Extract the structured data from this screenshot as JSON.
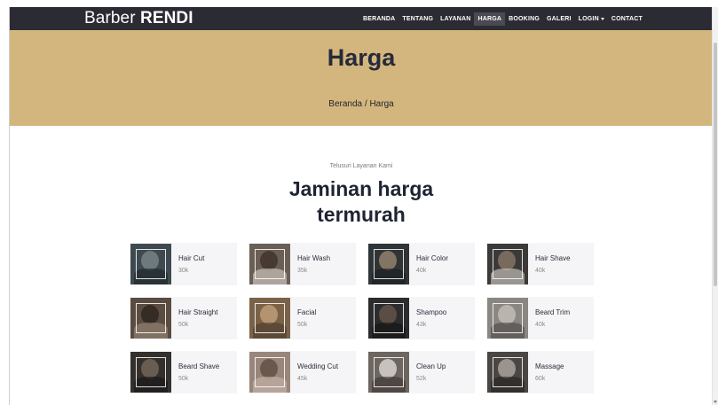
{
  "brand": {
    "prefix": "Barber ",
    "name": "RENDI"
  },
  "nav": [
    {
      "label": "BERANDA"
    },
    {
      "label": "TENTANG"
    },
    {
      "label": "LAYANAN"
    },
    {
      "label": "HARGA",
      "active": true
    },
    {
      "label": "BOOKING"
    },
    {
      "label": "GALERI"
    },
    {
      "label": "LOGIN"
    },
    {
      "label": "CONTACT"
    }
  ],
  "hero": {
    "title": "Harga",
    "breadcrumb": {
      "home": "Beranda",
      "separator": "/",
      "current": "Harga"
    },
    "background": "#d3b67d"
  },
  "section": {
    "subtitle": "Telusuri Layanan Kami",
    "title_line1": "Jaminan harga",
    "title_line2": "termurah"
  },
  "services": [
    {
      "name": "Hair Cut",
      "price": "30k"
    },
    {
      "name": "Hair Wash",
      "price": "35k"
    },
    {
      "name": "Hair Color",
      "price": "40k"
    },
    {
      "name": "Hair Shave",
      "price": "40k"
    },
    {
      "name": "Hair Straight",
      "price": "50k"
    },
    {
      "name": "Facial",
      "price": "50k"
    },
    {
      "name": "Shampoo",
      "price": "43k"
    },
    {
      "name": "Beard Trim",
      "price": "40k"
    },
    {
      "name": "Beard Shave",
      "price": "50k"
    },
    {
      "name": "Wedding Cut",
      "price": "45k"
    },
    {
      "name": "Clean Up",
      "price": "52k"
    },
    {
      "name": "Massage",
      "price": "60k"
    }
  ],
  "colors": {
    "navbar": "#2b2b33",
    "accent": "#d3b67d",
    "title": "#1f2433"
  }
}
